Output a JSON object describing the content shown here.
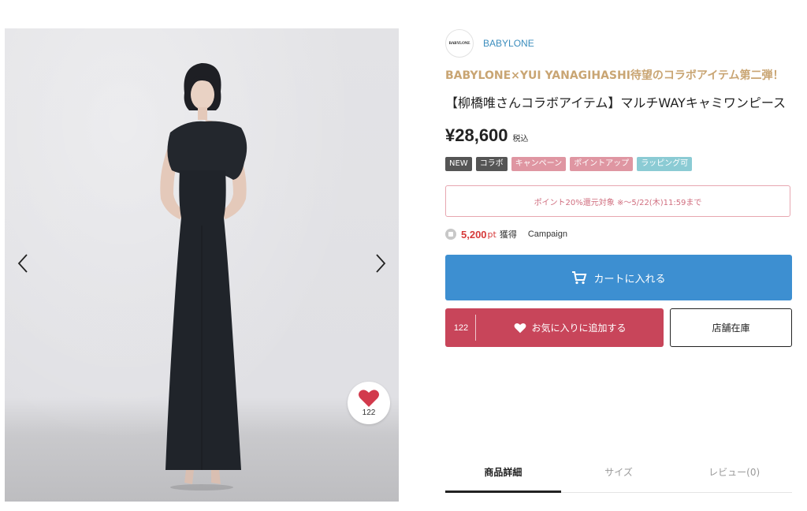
{
  "gallery": {
    "prev_icon": "chevron-left-icon",
    "next_icon": "chevron-right-icon",
    "favorite_count": "122"
  },
  "shop": {
    "logo_text": "BABYLONE",
    "name": "BABYLONE"
  },
  "product": {
    "catch_copy": "BABYLONE×YUI YANAGIHASHI待望のコラボアイテム第二弾！",
    "title": "【柳橋唯さんコラボアイテム】マルチWAYキャミワンピース",
    "price": "¥28,600",
    "tax_label": "税込",
    "tags": [
      {
        "label": "NEW",
        "color": "#555555"
      },
      {
        "label": "コラボ",
        "color": "#555555"
      },
      {
        "label": "キャンペーン",
        "color": "#df96a2"
      },
      {
        "label": "ポイントアップ",
        "color": "#df96a2"
      },
      {
        "label": "ラッピング可",
        "color": "#8bcbd4"
      }
    ],
    "point_notice": "ポイント20%還元対象 ※〜5/22(木)11:59まで",
    "earn": {
      "points": "5,200",
      "unit": "pt",
      "get_label": "獲得",
      "campaign_label": "Campaign"
    }
  },
  "actions": {
    "cart_label": "カートに入れる",
    "favorite_count": "122",
    "favorite_label": "お気に入りに追加する",
    "stock_label": "店舗在庫",
    "cart_color": "#3d8fd1",
    "favorite_color": "#c8455a"
  },
  "tabs": [
    {
      "label": "商品詳細",
      "active": true
    },
    {
      "label": "サイズ",
      "active": false
    },
    {
      "label": "レビュー(0)",
      "active": false
    }
  ]
}
